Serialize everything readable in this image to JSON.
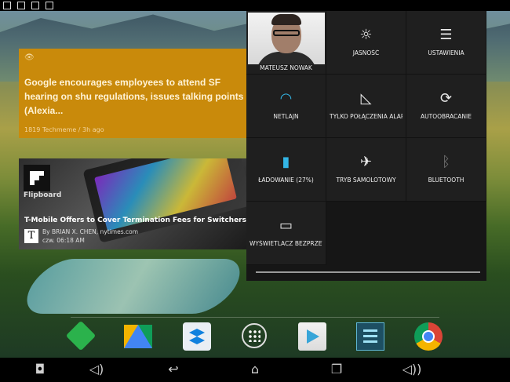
{
  "status_bar": {
    "icons": [
      "tabs-icon",
      "chat-icon",
      "picture-icon",
      "gmail-icon"
    ]
  },
  "widgets": {
    "news_card": {
      "headline": "Google encourages employees to attend SF hearing on shu regulations, issues talking points (Alexia...",
      "meta": "1819 Techmeme / 3h ago"
    },
    "flipboard_card": {
      "brand": "Flipboard",
      "title": "T-Mobile Offers to Cover Termination Fees for Switchers",
      "source_logo": "T",
      "byline": "By BRIAN X. CHEN, nytimes.com",
      "time": "czw. 06:18 AM"
    }
  },
  "quick_settings": {
    "user_name": "MATEUSZ NOWAK",
    "tiles": [
      {
        "label": "JASNOŚĆ",
        "icon": "☼"
      },
      {
        "label": "USTAWIENIA",
        "icon": "☰"
      },
      {
        "label": "NETLAJN",
        "icon": "◠"
      },
      {
        "label": "TYLKO POŁĄCZENIA ALARMOWE",
        "icon": "◺"
      },
      {
        "label": "AUTOOBRACANIE",
        "icon": "⟳"
      },
      {
        "label": "ŁADOWANIE (27%)",
        "icon": "▮"
      },
      {
        "label": "TRYB SAMOLOTOWY",
        "icon": "✈"
      },
      {
        "label": "BLUETOOTH",
        "icon": "ᛒ"
      },
      {
        "label": "WYŚWIETLACZ BEZPRZEWODOWY",
        "icon": "▭"
      }
    ],
    "battery_level": 27
  },
  "dock": {
    "apps": [
      "feedly-icon",
      "google-drive-icon",
      "dropbox-icon",
      "all-apps-icon",
      "play-store-icon",
      "settings-app-icon",
      "chrome-icon"
    ]
  },
  "nav_bar": {
    "icons": [
      "screenshot-icon",
      "volume-down-icon",
      "back-icon",
      "home-icon",
      "recent-apps-icon",
      "volume-up-icon"
    ]
  },
  "colors": {
    "news_card_bg": "#c98a0b",
    "quick_settings_bg": "#1f1f1f"
  }
}
